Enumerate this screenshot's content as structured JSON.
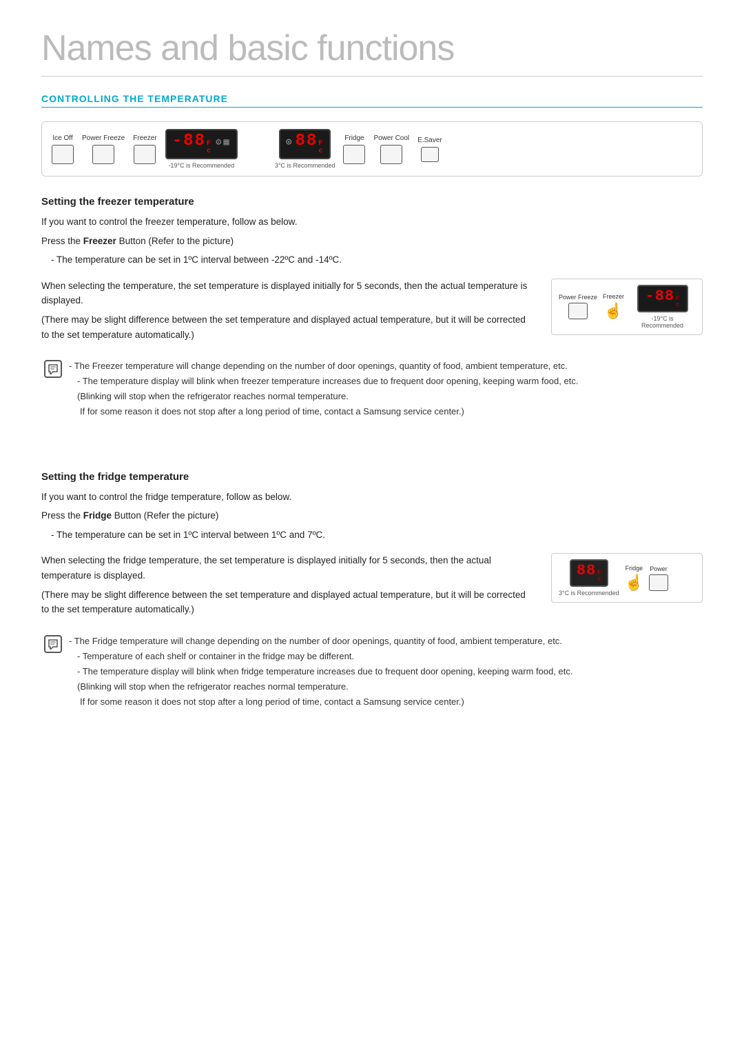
{
  "page": {
    "title": "Names and basic functions"
  },
  "section": {
    "header": "CONTROLLING THE TEMPERATURE"
  },
  "control_panel": {
    "groups": [
      {
        "label": "Ice Off",
        "type": "button"
      },
      {
        "label": "Power Freeze",
        "type": "button"
      },
      {
        "label": "Freezer",
        "type": "button"
      }
    ],
    "freezer_display": {
      "value": "-88",
      "unit_f": "F",
      "unit_c": "c",
      "recommend": "-19°C is Recommended"
    },
    "fridge_display": {
      "value": "88",
      "unit_f": "F",
      "unit_c": "c",
      "recommend": "3°C is Recommended"
    },
    "right_groups": [
      {
        "label": "Fridge",
        "type": "button"
      },
      {
        "label": "Power Cool",
        "type": "button"
      },
      {
        "label": "E.Saver",
        "type": "button"
      }
    ]
  },
  "freezer_section": {
    "title": "Setting the freezer temperature",
    "intro": "If you want to control the freezer temperature, follow as below.",
    "press_label": "Press the ",
    "press_bold": "Freezer",
    "press_rest": " Button (Refer to the picture)",
    "temp_range": "- The temperature can be set in 1ºC interval between -22ºC and -14ºC.",
    "when_text": "When selecting the temperature, the set temperature is displayed initially for 5 seconds, then the actual temperature is displayed.",
    "paren_text": "(There may be slight difference between the set temperature and displayed actual temperature, but it will be corrected to the set temperature automatically.)",
    "mini_panel": {
      "power_freeze_label": "Power Freeze",
      "freezer_label": "Freezer",
      "display_value": "-88",
      "unit_f": "F",
      "unit_c": "c",
      "recommend": "-19°C is Recommended"
    },
    "notes": [
      "- The Freezer temperature will change depending on the number of door openings, quantity of food, ambient temperature, etc.",
      "- The temperature display will blink when freezer temperature increases due to frequent door opening, keeping warm food, etc.",
      "(Blinking will stop when the refrigerator reaches normal temperature.",
      " If for some reason it does not stop after a long period of time, contact a Samsung service center.)"
    ]
  },
  "fridge_section": {
    "title": "Setting the fridge temperature",
    "intro": "If you want to control the fridge temperature, follow as below.",
    "press_label": "Press the ",
    "press_bold": "Fridge",
    "press_rest": " Button (Refer the picture)",
    "temp_range": "- The temperature can be set in 1ºC interval between 1ºC and 7ºC.",
    "when_text": "When selecting the fridge temperature, the set temperature is displayed initially for 5 seconds, then the actual temperature is displayed.",
    "paren_text": "(There may be slight difference between the set temperature and displayed actual temperature, but it will be corrected to the set temperature automatically.)",
    "mini_panel": {
      "fridge_label": "Fridge",
      "power_label": "Power",
      "display_value": "88",
      "unit_f": "F",
      "unit_c": "c",
      "recommend": "3°C is Recommended"
    },
    "notes": [
      "- The Fridge temperature will change depending on the number of door openings, quantity of food, ambient temperature, etc.",
      "- Temperature of each shelf or container in the fridge may be different.",
      "- The temperature display will blink when fridge temperature increases due to frequent door opening, keeping warm food, etc.",
      "(Blinking will stop when the refrigerator reaches normal temperature.",
      " If for some reason it does not stop after a long period of time, contact a Samsung service center.)"
    ]
  }
}
